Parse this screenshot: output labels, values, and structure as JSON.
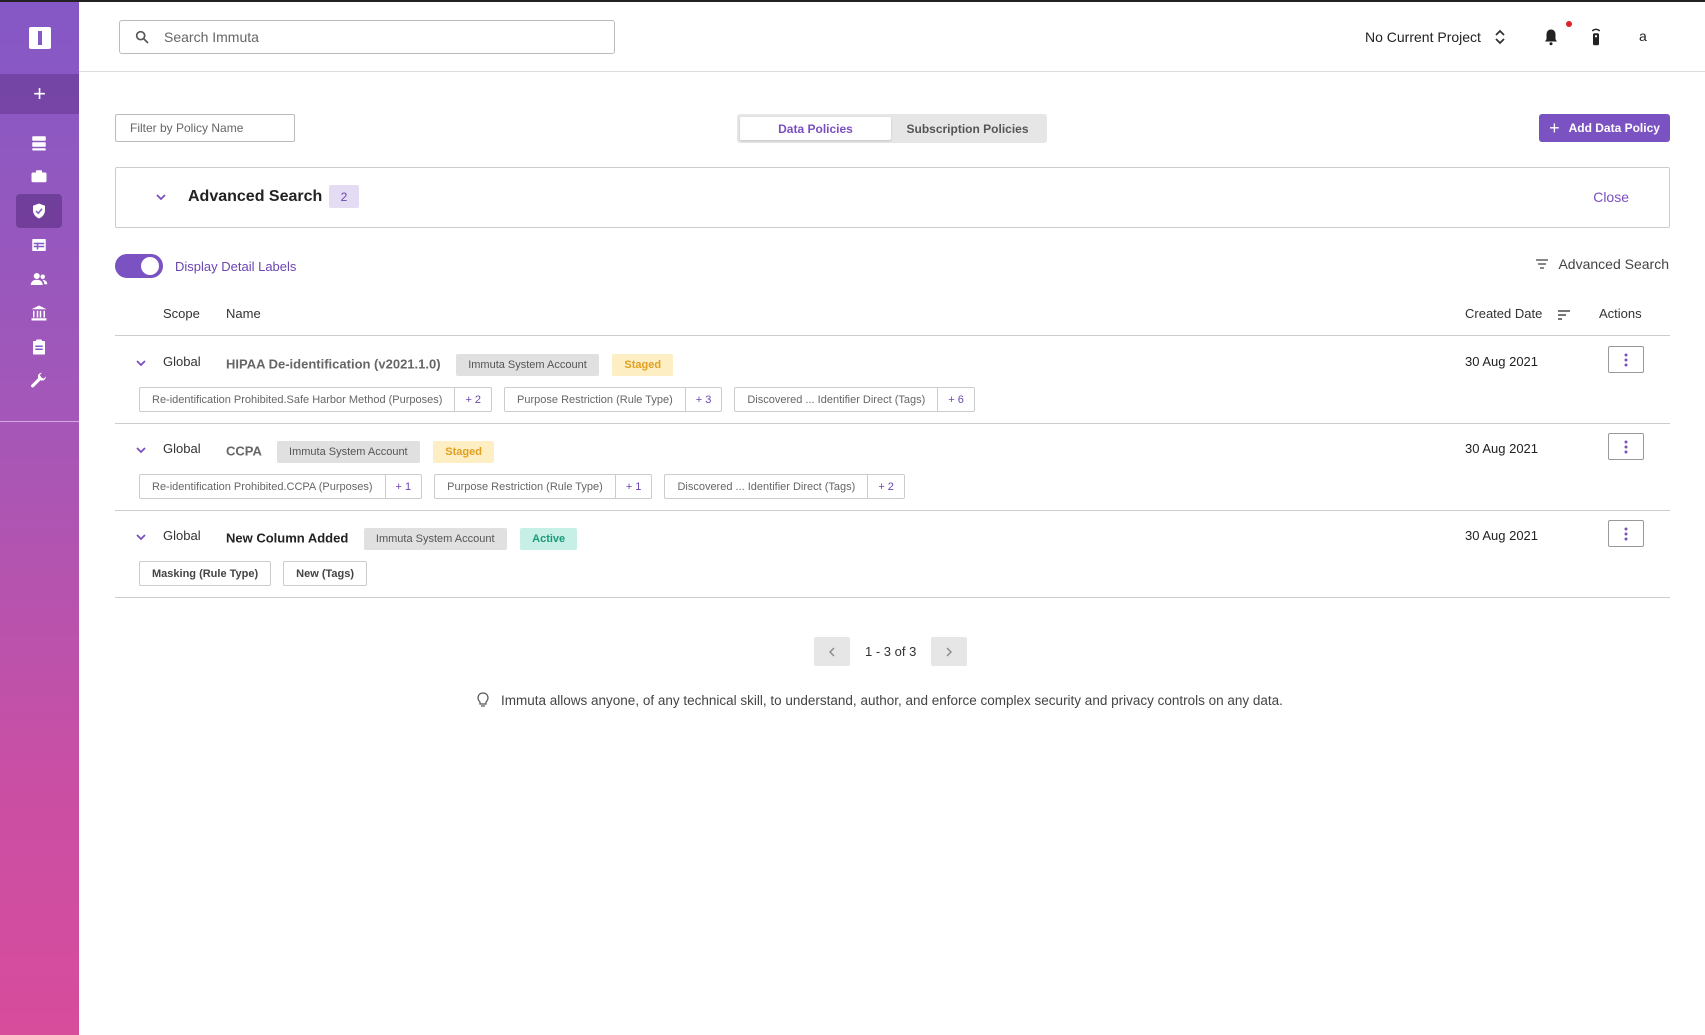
{
  "header": {
    "search_placeholder": "Search Immuta",
    "project": "No Current Project",
    "avatar": "a"
  },
  "sidebar": {
    "add": "+",
    "items": [
      {
        "icon": "data-sources-icon"
      },
      {
        "icon": "projects-icon"
      },
      {
        "icon": "policies-icon",
        "active": true
      },
      {
        "icon": "query-editor-icon"
      },
      {
        "icon": "people-icon"
      },
      {
        "icon": "governance-icon"
      },
      {
        "icon": "audit-icon"
      },
      {
        "icon": "settings-wrench-icon"
      }
    ]
  },
  "filter": {
    "placeholder": "Filter by Policy Name"
  },
  "tabs": [
    "Data Policies",
    "Subscription Policies"
  ],
  "add_button": "Add Data Policy",
  "advanced": {
    "title": "Advanced Search",
    "count": "2",
    "close": "Close",
    "link": "Advanced Search"
  },
  "toggle_label": "Display Detail Labels",
  "table": {
    "headers": {
      "scope": "Scope",
      "name": "Name",
      "created": "Created Date",
      "actions": "Actions"
    },
    "rows": [
      {
        "scope": "Global",
        "name": "HIPAA De-identification (v2021.1.0)",
        "account": "Immuta System Account",
        "status": "Staged",
        "date": "30 Aug 2021",
        "tags": [
          {
            "text": "Re-identification Prohibited.Safe Harbor Method (Purposes)",
            "more": "+ 2"
          },
          {
            "text": "Purpose Restriction (Rule Type)",
            "more": "+ 3"
          },
          {
            "text": "Discovered ... Identifier Direct (Tags)",
            "more": "+ 6"
          }
        ]
      },
      {
        "scope": "Global",
        "name": "CCPA",
        "account": "Immuta System Account",
        "status": "Staged",
        "date": "30 Aug 2021",
        "tags": [
          {
            "text": "Re-identification Prohibited.CCPA (Purposes)",
            "more": "+ 1"
          },
          {
            "text": "Purpose Restriction (Rule Type)",
            "more": "+ 1"
          },
          {
            "text": "Discovered ... Identifier Direct (Tags)",
            "more": "+ 2"
          }
        ]
      },
      {
        "scope": "Global",
        "name": "New Column Added",
        "account": "Immuta System Account",
        "status": "Active",
        "date": "30 Aug 2021",
        "tags": [
          {
            "text": "Masking (Rule Type)"
          },
          {
            "text": "New (Tags)"
          }
        ]
      }
    ]
  },
  "pager": "1 - 3 of 3",
  "tip": "Immuta allows anyone, of any technical skill, to understand, author, and enforce complex security and privacy controls on any data.",
  "colors": {
    "accent": "#7b52c1",
    "staged": "#e0a020",
    "active": "#1a9a7a"
  }
}
